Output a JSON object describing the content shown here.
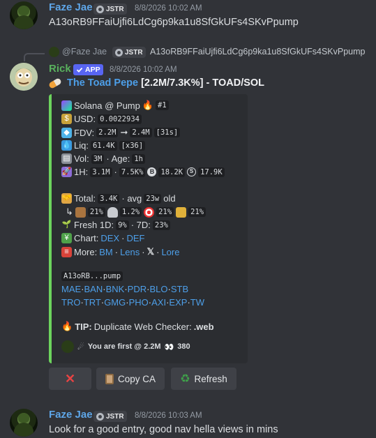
{
  "messages": [
    {
      "author": "Faze Jae",
      "guild_tag": "JSTR",
      "timestamp": "8/8/2026 10:02 AM",
      "text": "A13oRB9FFaiUjfi6LdCg6p9ka1u8SfGkUFs4SKvPpump"
    },
    {
      "reply": {
        "author": "@Faze Jae",
        "guild_tag": "JSTR",
        "text": "A13oRB9FFaiUjfi6LdCg6p9ka1u8SfGkUFs4SKvPpump"
      },
      "author": "Rick",
      "app_badge": "APP",
      "timestamp": "8/8/2026 10:02 AM",
      "title_link": "The Toad Pepe",
      "title_rest": "[2.2M/7.3K%] - TOAD/SOL"
    },
    {
      "author": "Faze Jae",
      "guild_tag": "JSTR",
      "timestamp": "8/8/2026 10:03 AM",
      "text": "Look for a good entry, good nav hella views in mins"
    }
  ],
  "embed": {
    "chain": "Solana @ Pump",
    "rank": "#1",
    "usd_label": "USD:",
    "usd": "0.0022934",
    "fdv_label": "FDV:",
    "fdv_from": "2.2M",
    "arrow": "➞",
    "fdv_to": "2.4M",
    "fdv_time": "[31s]",
    "liq_label": "Liq:",
    "liq": "61.4K",
    "liq_mult": "[x36]",
    "vol_label": "Vol:",
    "vol": "3M",
    "age_label": "· Age:",
    "age": "1h",
    "h1_label": "1H:",
    "h1_vol": "3.1M",
    "h1_pct": "7.5K%",
    "h1_b": "18.2K",
    "h1_s": "17.9K",
    "total_label": "Total:",
    "total": "3.4K",
    "avg_label": "· avg",
    "avg": "23w",
    "old_label": "old",
    "holders": [
      "21%",
      "1.2%",
      "21%",
      "21%"
    ],
    "fresh_label": "Fresh 1D:",
    "fresh_1d": "9%",
    "fresh_7d_label": "· 7D:",
    "fresh_7d": "23%",
    "chart_label": "Chart:",
    "chart_links": [
      "DEX",
      "DEF"
    ],
    "more_label": "More:",
    "more_links": [
      "BM",
      "Lens",
      "𝕏",
      "Lore"
    ],
    "ca_short": "A13oRB...pump",
    "trade_links_1": [
      "MAE",
      "BAN",
      "BNK",
      "PDR",
      "BLO",
      "STB"
    ],
    "trade_links_2": [
      "TRO",
      "TRT",
      "GMG",
      "PHO",
      "AXI",
      "EXP",
      "TW"
    ],
    "tip_label": "TIP:",
    "tip_text": "Duplicate Web Checker:",
    "tip_code": ".web",
    "footer_text": "You are first @ 2.2M",
    "footer_count": "380"
  },
  "buttons": {
    "close": "✕",
    "copy": "Copy CA",
    "refresh": "Refresh"
  },
  "colors": {
    "background": "#313338",
    "embed_bar": "#6cd35d",
    "link": "#4d9fe9",
    "faze_name": "#5ea6e8",
    "rick_name": "#58b15d"
  }
}
